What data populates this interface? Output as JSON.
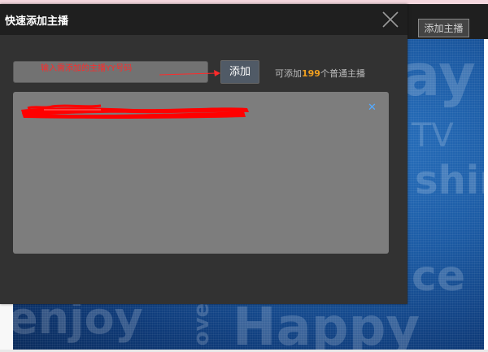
{
  "background": {
    "header_button_label": "添加主播",
    "words": [
      "ay",
      "TV",
      "shin",
      "ce",
      "enjoy",
      "ove",
      "Happy"
    ]
  },
  "modal": {
    "title": "快速添加主播",
    "input": {
      "value": "",
      "annotation_text": "输入需添加的主播YY号码"
    },
    "add_button_label": "添加",
    "quota": {
      "prefix": "可添加",
      "count": "199",
      "suffix": "个普通主播"
    },
    "list": {
      "items": [
        {
          "remove_icon": "close-icon"
        }
      ]
    }
  },
  "colors": {
    "modal_bg": "#323232",
    "header_bg": "#1f1f1f",
    "accent_orange": "#f0a020",
    "annotation_red": "#ff2a2a",
    "remove_blue": "#55aaff"
  }
}
